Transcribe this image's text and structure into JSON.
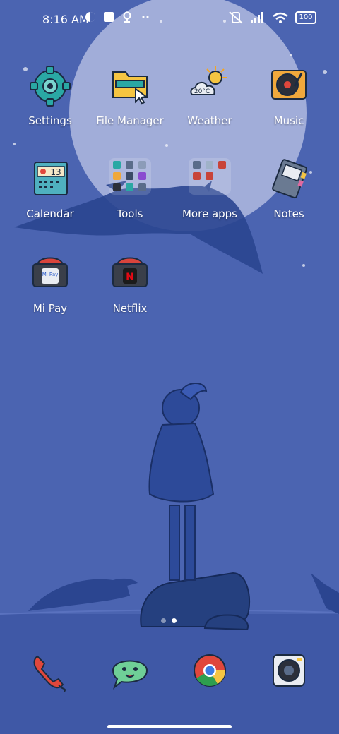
{
  "status_bar": {
    "time": "8:16 AM",
    "battery_level": "100"
  },
  "apps": {
    "settings": {
      "label": "Settings"
    },
    "file_manager": {
      "label": "File Manager"
    },
    "weather": {
      "label": "Weather",
      "temperature": "20°C"
    },
    "music": {
      "label": "Music"
    },
    "calendar": {
      "label": "Calendar",
      "day": "13"
    },
    "tools": {
      "label": "Tools"
    },
    "more_apps": {
      "label": "More apps"
    },
    "notes": {
      "label": "Notes"
    },
    "mi_pay": {
      "label": "Mi Pay",
      "badge_text": "Mi Pay"
    },
    "netflix": {
      "label": "Netflix",
      "badge_text": "N"
    }
  },
  "dock": {
    "items": [
      {
        "icon": "phone-icon"
      },
      {
        "icon": "messages-icon"
      },
      {
        "icon": "chrome-icon"
      },
      {
        "icon": "camera-icon"
      }
    ]
  },
  "pages": {
    "count": 2,
    "active": 2
  },
  "colors": {
    "wallpaper": "#4a63b0",
    "moon": "#aab5de",
    "text": "#ffffff"
  }
}
